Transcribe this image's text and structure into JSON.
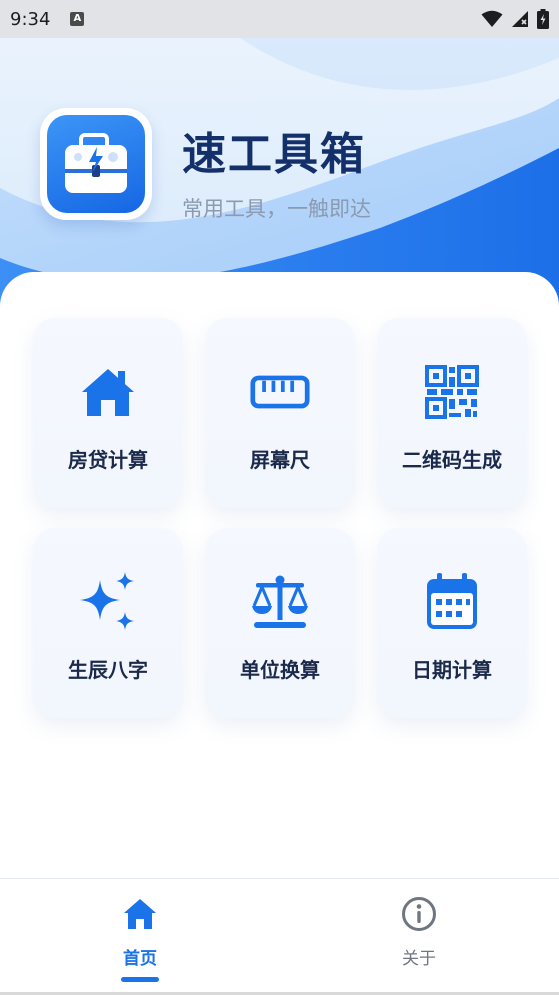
{
  "status_bar": {
    "time": "9:34",
    "notification_icon": "a-icon",
    "icons": [
      "wifi-icon",
      "signal-icon",
      "battery-icon"
    ]
  },
  "header": {
    "title": "速工具箱",
    "subtitle": "常用工具，一触即达",
    "logo_icon": "toolbox-icon"
  },
  "colors": {
    "accent": "#1a73e8",
    "title": "#13306a",
    "label": "#1b2a4a",
    "subtitle": "#8b9ab1"
  },
  "tools": [
    {
      "label": "房贷计算",
      "icon": "house-icon"
    },
    {
      "label": "屏幕尺",
      "icon": "ruler-icon"
    },
    {
      "label": "二维码生成",
      "icon": "qr-code-icon"
    },
    {
      "label": "生辰八字",
      "icon": "sparkle-icon"
    },
    {
      "label": "单位换算",
      "icon": "scale-icon"
    },
    {
      "label": "日期计算",
      "icon": "calendar-icon"
    }
  ],
  "bottom_nav": {
    "items": [
      {
        "label": "首页",
        "icon": "home-icon",
        "active": true
      },
      {
        "label": "关于",
        "icon": "info-icon",
        "active": false
      }
    ]
  }
}
